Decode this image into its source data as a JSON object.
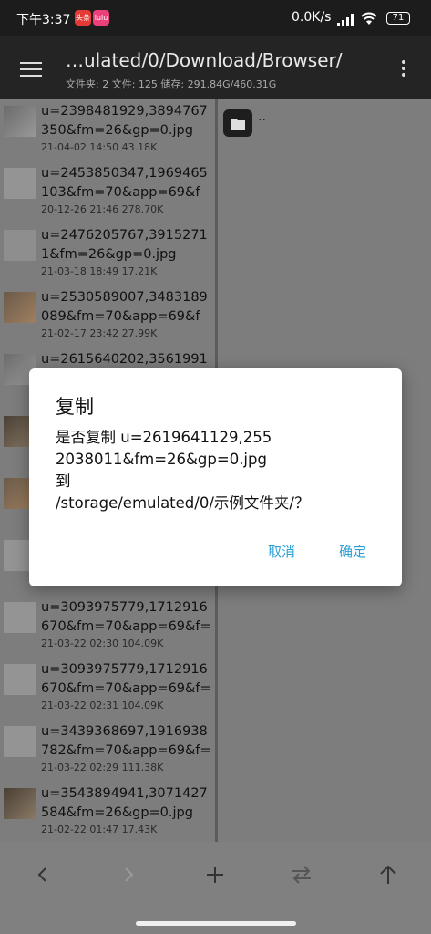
{
  "status_bar": {
    "time": "下午3:37",
    "badge1": "头条",
    "badge2": "lulu",
    "net_speed": "0.0K/s",
    "battery": "71"
  },
  "app_bar": {
    "path": "…ulated/0/Download/Browser/",
    "stats": "文件夹: 2   文件: 125   储存: 291.84G/460.31G"
  },
  "files": [
    {
      "name": "u=2398481929,3894767350&fm=26&gp=0.jpg",
      "meta": "21-04-02 14:50  43.18K"
    },
    {
      "name": "u=2453850347,1969465103&fm=70&app=69&f=…",
      "meta": "20-12-26 21:46  278.70K"
    },
    {
      "name": "u=2476205767,3915271 1&fm=26&gp=0.jpg",
      "meta": "21-03-18 18:49  17.21K"
    },
    {
      "name": "u=2530589007,3483189089&fm=70&app=69&f=…",
      "meta": "21-02-17 23:42  27.99K"
    },
    {
      "name": "u=2615640202,35619914",
      "meta": ""
    },
    {
      "name": "",
      "meta": ""
    },
    {
      "name": "",
      "meta": ""
    },
    {
      "name": "",
      "meta": ""
    },
    {
      "name": "u=3093975779,1712916670&fm=70&app=69&f=J…",
      "meta": "21-03-22 02:30  104.09K"
    },
    {
      "name": "u=3093975779,1712916670&fm=70&app=69&f=J…",
      "meta": "21-03-22 02:31  104.09K"
    },
    {
      "name": "u=3439368697,1916938782&fm=70&app=69&f=J…",
      "meta": "21-03-22 02:29  111.38K"
    },
    {
      "name": "u=3543894941,3071427584&fm=26&gp=0.jpg",
      "meta": "21-02-22 01:47  17.43K"
    }
  ],
  "right_pane": {
    "parent_label": ".."
  },
  "dialog": {
    "title": "复制",
    "line1": "是否复制 u=2619641129,255",
    "line2": "2038011&fm=26&gp=0.jpg",
    "line3": "到",
    "line4": "/storage/emulated/0/示例文件夹/？",
    "cancel": "取消",
    "ok": "确定"
  },
  "colors": {
    "accent": "#2a9fd6",
    "app_bar": "#242424",
    "scrim_pane": "#7d7d7d"
  },
  "toolbar_icons": [
    "back-icon",
    "forward-icon",
    "add-icon",
    "swap-icon",
    "up-icon"
  ]
}
